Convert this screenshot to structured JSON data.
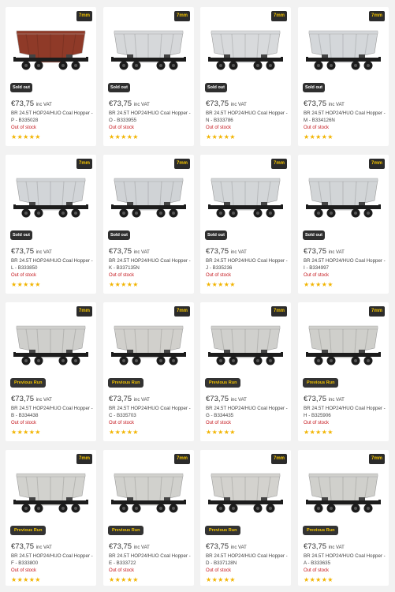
{
  "products": [
    {
      "scale": "7mm",
      "badge": "Sold out",
      "badge_type": "sold",
      "price": "€73,75",
      "vat": "inc VAT",
      "title": "BR 24.5T HOP24/HUO Coal Hopper - P - B335028",
      "stock": "Out of stock",
      "stars": "★★★★★",
      "rating": 5,
      "body_color": "#8f3a28"
    },
    {
      "scale": "7mm",
      "badge": "Sold out",
      "badge_type": "sold",
      "price": "€73,75",
      "vat": "inc VAT",
      "title": "BR 24.5T HOP24/HUO Coal Hopper - O - B333955",
      "stock": "Out of stock",
      "stars": "★★★★★",
      "rating": 5,
      "body_color": "#d6d8da"
    },
    {
      "scale": "7mm",
      "badge": "Sold out",
      "badge_type": "sold",
      "price": "€73,75",
      "vat": "inc VAT",
      "title": "BR 24.5T HOP24/HUO Coal Hopper - N - B333786",
      "stock": "Out of stock",
      "stars": "★★★★★",
      "rating": 5,
      "body_color": "#d8dadc"
    },
    {
      "scale": "7mm",
      "badge": "Sold out",
      "badge_type": "sold",
      "price": "€73,75",
      "vat": "inc VAT",
      "title": "BR 24.5T HOP24/HUO Coal Hopper - M - B334126N",
      "stock": "Out of stock",
      "stars": "★★★★★",
      "rating": 4.5,
      "body_color": "#d4d7da"
    },
    {
      "scale": "7mm",
      "badge": "Sold out",
      "badge_type": "sold",
      "price": "€73,75",
      "vat": "inc VAT",
      "title": "BR 24.5T HOP24/HUO Coal Hopper - L - B333850",
      "stock": "Out of stock",
      "stars": "★★★★★",
      "rating": 5,
      "body_color": "#d2d5d8"
    },
    {
      "scale": "7mm",
      "badge": "Sold out",
      "badge_type": "sold",
      "price": "€73,75",
      "vat": "inc VAT",
      "title": "BR 24.5T HOP24/HUO Coal Hopper - K - B337135N",
      "stock": "Out of stock",
      "stars": "★★★★★",
      "rating": 5,
      "body_color": "#d0d3d6"
    },
    {
      "scale": "7mm",
      "badge": "Sold out",
      "badge_type": "sold",
      "price": "€73,75",
      "vat": "inc VAT",
      "title": "BR 24.5T HOP24/HUO Coal Hopper - J - B335236",
      "stock": "Out of stock",
      "stars": "★★★★★",
      "rating": 5,
      "body_color": "#d3d6d8"
    },
    {
      "scale": "7mm",
      "badge": "Sold out",
      "badge_type": "sold",
      "price": "€73,75",
      "vat": "inc VAT",
      "title": "BR 24.5T HOP24/HUO Coal Hopper - I - B334997",
      "stock": "Out of stock",
      "stars": "★★★★★",
      "rating": 5,
      "body_color": "#d2d5d7"
    },
    {
      "scale": "7mm",
      "badge": "Previous Run",
      "badge_type": "prev",
      "price": "€73,75",
      "vat": "inc VAT",
      "title": "BR 24.5T HOP24/HUO Coal Hopper - B - B334438",
      "stock": "Out of stock",
      "stars": "★★★★★",
      "rating": 5,
      "body_color": "#cfcfcc"
    },
    {
      "scale": "7mm",
      "badge": "Previous Run",
      "badge_type": "prev",
      "price": "€73,75",
      "vat": "inc VAT",
      "title": "BR 24.5T HOP24/HUO Coal Hopper - C - B335703",
      "stock": "Out of stock",
      "stars": "★★★★★",
      "rating": 5,
      "body_color": "#d1d0cc"
    },
    {
      "scale": "7mm",
      "badge": "Previous Run",
      "badge_type": "prev",
      "price": "€73,75",
      "vat": "inc VAT",
      "title": "BR 24.5T HOP24/HUO Coal Hopper - G - B334435",
      "stock": "Out of stock",
      "stars": "★★★★★",
      "rating": 5,
      "body_color": "#d0d0cd"
    },
    {
      "scale": "7mm",
      "badge": "Previous Run",
      "badge_type": "prev",
      "price": "€73,75",
      "vat": "inc VAT",
      "title": "BR 24.5T HOP24/HUO Coal Hopper - H - B325906",
      "stock": "Out of stock",
      "stars": "★★★★★",
      "rating": 5,
      "body_color": "#cfcfcb"
    },
    {
      "scale": "7mm",
      "badge": "Previous Run",
      "badge_type": "prev",
      "price": "€73,75",
      "vat": "inc VAT",
      "title": "BR 24.5T HOP24/HUO Coal Hopper - F - B333800",
      "stock": "Out of stock",
      "stars": "★★★★★",
      "rating": 5,
      "body_color": "#d2d2ce"
    },
    {
      "scale": "7mm",
      "badge": "Previous Run",
      "badge_type": "prev",
      "price": "€73,75",
      "vat": "inc VAT",
      "title": "BR 24.5T HOP24/HUO Coal Hopper - E - B333722",
      "stock": "Out of stock",
      "stars": "★★★★★",
      "rating": 5,
      "body_color": "#d1d1cd"
    },
    {
      "scale": "7mm",
      "badge": "Previous Run",
      "badge_type": "prev",
      "price": "€73,75",
      "vat": "inc VAT",
      "title": "BR 24.5T HOP24/HUO Coal Hopper - D - B337128N",
      "stock": "Out of stock",
      "stars": "★★★★★",
      "rating": 5,
      "body_color": "#d3d2ce"
    },
    {
      "scale": "7mm",
      "badge": "Previous Run",
      "badge_type": "prev",
      "price": "€73,75",
      "vat": "inc VAT",
      "title": "BR 24.5T HOP24/HUO Coal Hopper - A - B333635",
      "stock": "Out of stock",
      "stars": "★★★★★",
      "rating": 5,
      "body_color": "#d0d0cc"
    }
  ],
  "colors": {
    "accent_yellow": "#f2c300",
    "star_color": "#f2b400",
    "out_of_stock_red": "#c4161c"
  }
}
